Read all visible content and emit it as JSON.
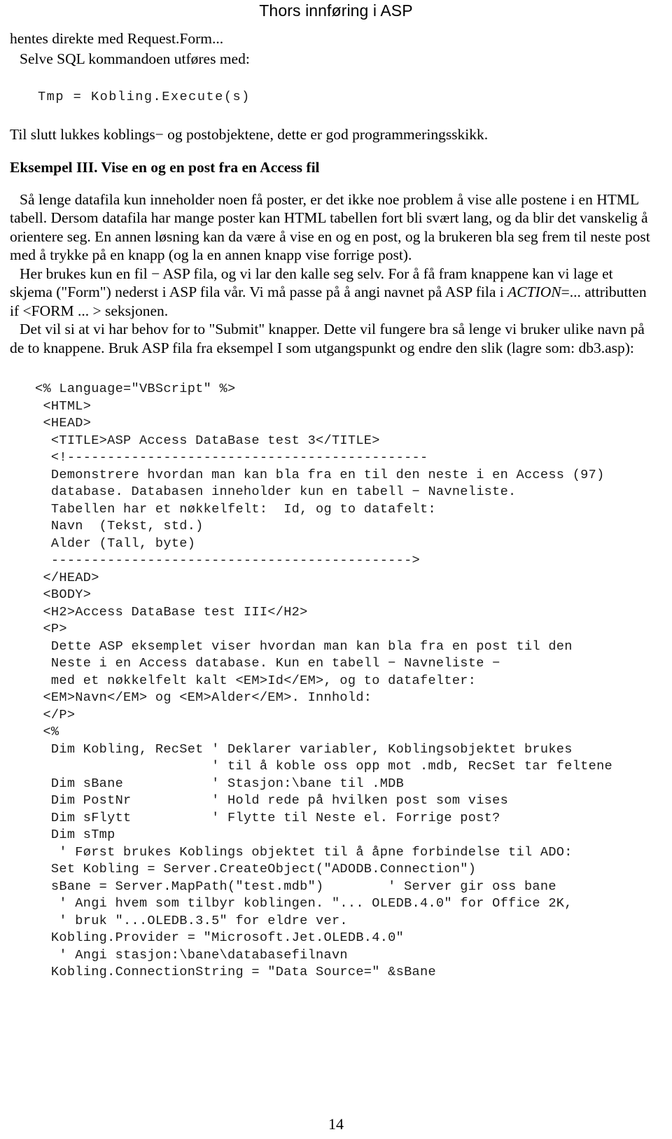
{
  "header": {
    "running_head": "Thors innføring i ASP"
  },
  "body": {
    "line_request_form": "hentes direkte med Request.Form...",
    "line_sql": "Selve SQL kommandoen utføres med:",
    "code_execute": "Tmp = Kobling.Execute(s)",
    "line_close": "Til slutt lukkes koblings− og postobjektene, dette er god programmeringsskikk.",
    "example_heading": "Eksempel III. Vise en og en post fra en Access fil",
    "paragraph_1": "Så lenge datafila kun inneholder noen få poster, er det ikke noe problem å vise alle postene i en HTML tabell. Dersom datafila har mange poster kan HTML tabellen fort bli svært lang, og da blir det vanskelig å orientere seg. En annen løsning kan da være å vise en og en post, og la brukeren bla seg frem til neste post med å trykke på en knapp (og la en annen knapp vise forrige post).",
    "paragraph_2_a": "Her brukes kun en fil − ASP fila, og vi lar den kalle seg selv. For å få fram knappene kan vi lage et skjema (\"Form\") nederst i ASP fila vår. Vi må passe på å angi navnet på ASP fila i ",
    "paragraph_2_italic": "ACTION",
    "paragraph_2_b": "=... attributten if <FORM ... > seksjonen.",
    "paragraph_3": "Det vil si at vi har behov for to \"Submit\" knapper. Dette vil fungere bra så lenge vi bruker ulike navn på de to knappene. Bruk ASP fila fra eksempel I som utgangspunkt og endre den slik (lagre som: db3.asp):"
  },
  "code_listing": {
    "lines": "<% Language=\"VBScript\" %>\n <HTML>\n <HEAD>\n  <TITLE>ASP Access DataBase test 3</TITLE>\n  <!---------------------------------------------\n  Demonstrere hvordan man kan bla fra en til den neste i en Access (97)\n  database. Databasen inneholder kun en tabell − Navneliste.\n  Tabellen har et nøkkelfelt:  Id, og to datafelt:\n  Navn  (Tekst, std.)\n  Alder (Tall, byte)\n  --------------------------------------------->\n </HEAD>\n <BODY>\n <H2>Access DataBase test III</H2>\n <P>\n  Dette ASP eksemplet viser hvordan man kan bla fra en post til den\n  Neste i en Access database. Kun en tabell − Navneliste −\n  med et nøkkelfelt kalt <EM>Id</EM>, og to datafelter:\n <EM>Navn</EM> og <EM>Alder</EM>. Innhold:\n </P>\n <%\n  Dim Kobling, RecSet ' Deklarer variabler, Koblingsobjektet brukes\n                      ' til å koble oss opp mot .mdb, RecSet tar feltene\n  Dim sBane           ' Stasjon:\\bane til .MDB\n  Dim PostNr          ' Hold rede på hvilken post som vises\n  Dim sFlytt          ' Flytte til Neste el. Forrige post?\n  Dim sTmp\n   ' Først brukes Koblings objektet til å åpne forbindelse til ADO:\n  Set Kobling = Server.CreateObject(\"ADODB.Connection\")\n  sBane = Server.MapPath(\"test.mdb\")        ' Server gir oss bane\n   ' Angi hvem som tilbyr koblingen. \"... OLEDB.4.0\" for Office 2K,\n   ' bruk \"...OLEDB.3.5\" for eldre ver.\n  Kobling.Provider = \"Microsoft.Jet.OLEDB.4.0\"\n   ' Angi stasjon:\\bane\\databasefilnavn\n  Kobling.ConnectionString = \"Data Source=\" &sBane"
  },
  "footer": {
    "page_number": "14"
  }
}
